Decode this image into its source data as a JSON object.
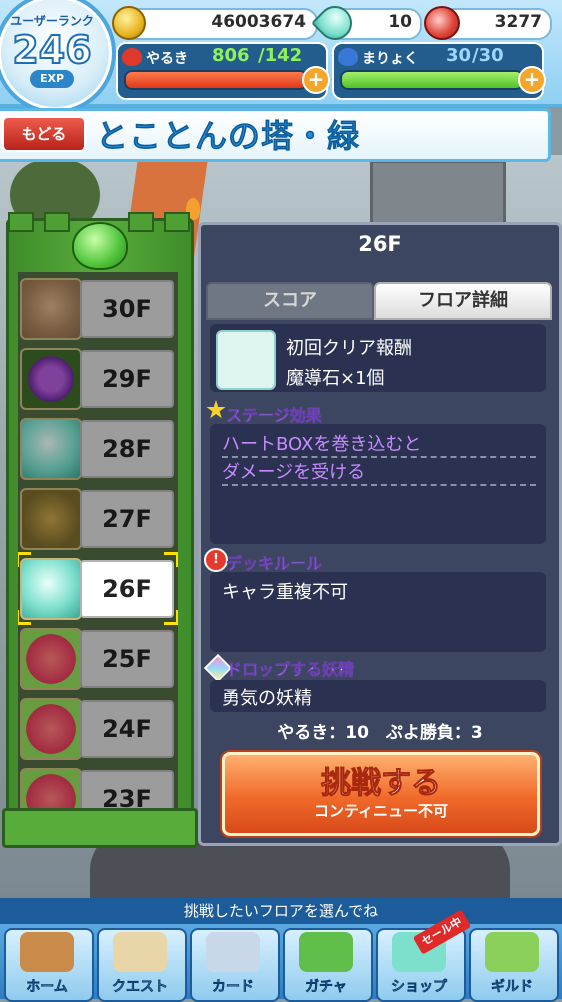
{
  "status": {
    "rank_label": "ユーザーランク",
    "rank_value": "246",
    "exp_label": "EXP",
    "coins": "46003674",
    "gems": "10",
    "meat": "3277",
    "stamina": {
      "label": "やるき",
      "current": "806",
      "max": "/142"
    },
    "mana": {
      "label": "まりょく",
      "current": "30",
      "max": "/30"
    },
    "plus_symbol": "+"
  },
  "header": {
    "back_label": "もどる",
    "title": "とことんの塔・緑"
  },
  "floors": [
    {
      "label": "30F",
      "icon": "ogre-plush-icon",
      "selected": false
    },
    {
      "label": "29F",
      "icon": "planet-icon",
      "selected": false
    },
    {
      "label": "28F",
      "icon": "magic-stone-icon",
      "selected": false
    },
    {
      "label": "27F",
      "icon": "banana-icon",
      "selected": false
    },
    {
      "label": "26F",
      "icon": "magic-stone-icon",
      "selected": true
    },
    {
      "label": "25F",
      "icon": "crown-puyo-icon",
      "selected": false
    },
    {
      "label": "24F",
      "icon": "crown-puyo-icon",
      "selected": false
    },
    {
      "label": "23F",
      "icon": "crown-puyo-icon",
      "selected": false
    }
  ],
  "detail": {
    "floor": "26F",
    "tabs": {
      "score": "スコア",
      "floor_detail": "フロア詳細"
    },
    "reward_title": "初回クリア報酬",
    "reward_item": "魔導石×1個",
    "stage_effect_title": "ステージ効果",
    "stage_effect_line1": "ハートBOXを巻き込むと",
    "stage_effect_line2": "ダメージを受ける",
    "deck_rule_title": "デッキルール",
    "deck_rule": "キャラ重複不可",
    "fairy_title": "ドロップする妖精",
    "fairy": "勇気の妖精",
    "cost_text": "やるき：10　ぷよ勝負：3",
    "challenge_label": "挑戦する",
    "challenge_sub": "コンティニュー不可"
  },
  "bottom": {
    "hint": "挑戦したいフロアを選んでね",
    "sale_badge": "セール中",
    "nav": [
      {
        "label": "ホーム",
        "icon": "house-icon"
      },
      {
        "label": "クエスト",
        "icon": "map-icon"
      },
      {
        "label": "カード",
        "icon": "card-icon"
      },
      {
        "label": "ガチャ",
        "icon": "puyo-gacha-icon"
      },
      {
        "label": "ショップ",
        "icon": "magic-stone-shop-icon"
      },
      {
        "label": "ギルド",
        "icon": "guild-tower-icon"
      }
    ]
  },
  "colors": {
    "accent_blue": "#2a8cd4",
    "tower_green": "#58ad3a",
    "panel_navy": "#3d4660",
    "challenge_orange": "#f06a2a"
  }
}
